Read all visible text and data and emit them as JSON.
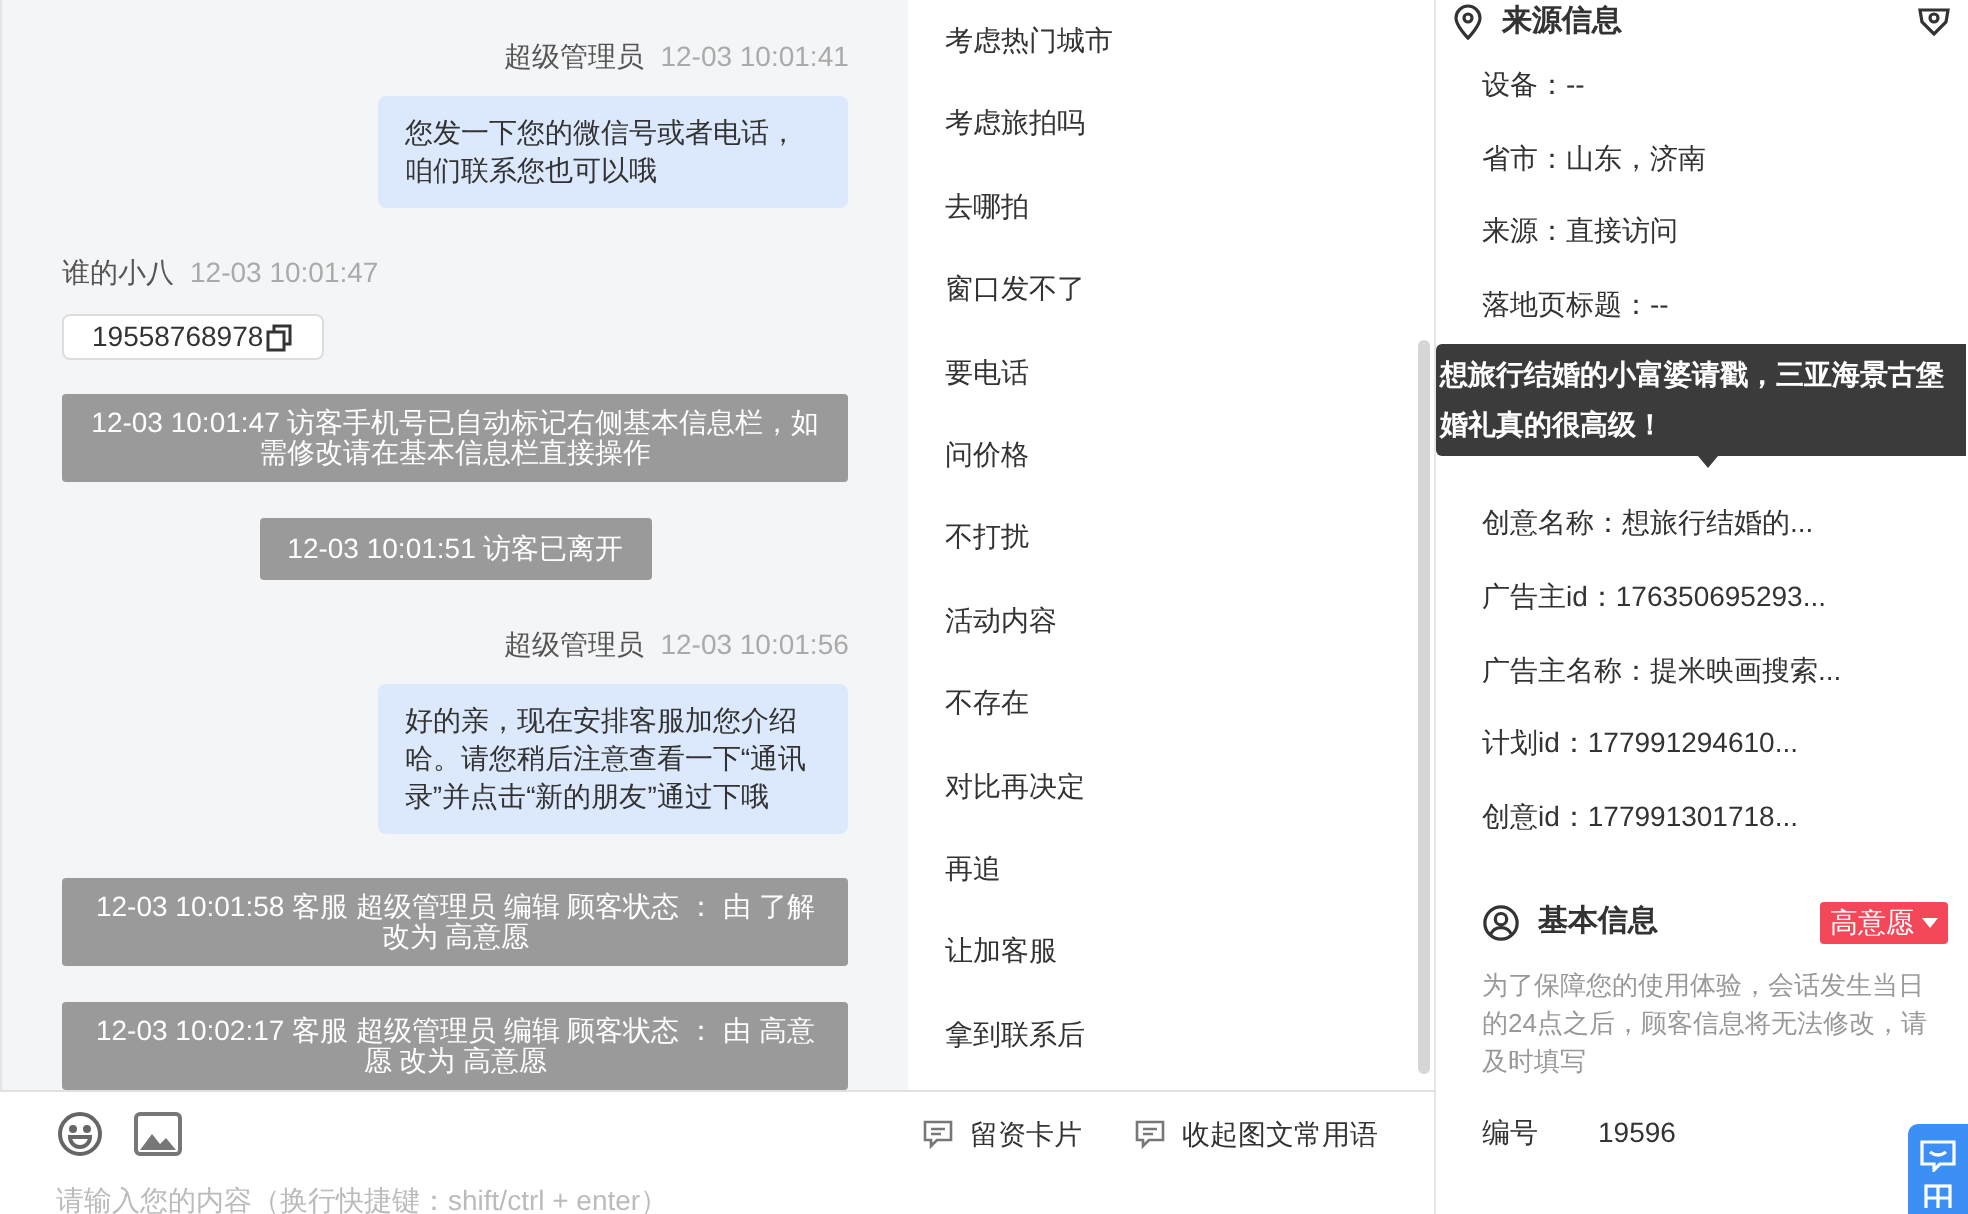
{
  "chat": {
    "messages": [
      {
        "kind": "agent",
        "sender": "超级管理员",
        "time": "12-03 10:01:41",
        "text": "您发一下您的微信号或者电话，咱们联系您也可以哦"
      },
      {
        "kind": "visitor",
        "sender": "谁的小八",
        "time": "12-03 10:01:47",
        "text": "19558768978"
      },
      {
        "kind": "system",
        "text": "12-03 10:01:47 访客手机号已自动标记右侧基本信息栏，如需修改请在基本信息栏直接操作"
      },
      {
        "kind": "notice",
        "text": "12-03 10:01:51 访客已离开"
      },
      {
        "kind": "agent",
        "sender": "超级管理员",
        "time": "12-03 10:01:56",
        "text": "好的亲，现在安排客服加您介绍哈。请您稍后注意查看一下“通讯录”并点击“新的朋友”通过下哦"
      },
      {
        "kind": "system",
        "text": "12-03 10:01:58 客服 超级管理员 编辑 顾客状态 ： 由 了解改为 高意愿"
      },
      {
        "kind": "system",
        "text": "12-03 10:02:17 客服 超级管理员 编辑 顾客状态 ： 由 高意愿 改为 高意愿"
      }
    ],
    "toolbar": {
      "card_button": "留资卡片",
      "collapse_button": "收起图文常用语"
    },
    "input": {
      "placeholder": "请输入您的内容（换行快捷键：shift/ctrl + enter）"
    }
  },
  "phrases": [
    "考虑热门城市",
    "考虑旅拍吗",
    "去哪拍",
    "窗口发不了",
    "要电话",
    "问价格",
    "不打扰",
    "活动内容",
    "不存在",
    "对比再决定",
    "再追",
    "让加客服",
    "拿到联系后"
  ],
  "source_info": {
    "title": "来源信息",
    "rows_before": [
      "设备：--",
      "省市：山东，济南",
      "来源：直接访问",
      "落地页标题：--"
    ],
    "tooltip": "想旅行结婚的小富婆请戳，三亚海景古堡婚礼真的很高级！",
    "rows_after": [
      "创意名称：想旅行结婚的...",
      "广告主id：176350695293...",
      "广告主名称：提米映画搜索...",
      "计划id：177991294610...",
      "创意id：177991301718..."
    ]
  },
  "basic_info": {
    "title": "基本信息",
    "status_tag": "高意愿",
    "notice": "为了保障您的使用体验，会话发生当日的24点之后，顾客信息将无法修改，请及时填写",
    "fields": [
      {
        "label": "编号",
        "value": "19596"
      }
    ]
  }
}
